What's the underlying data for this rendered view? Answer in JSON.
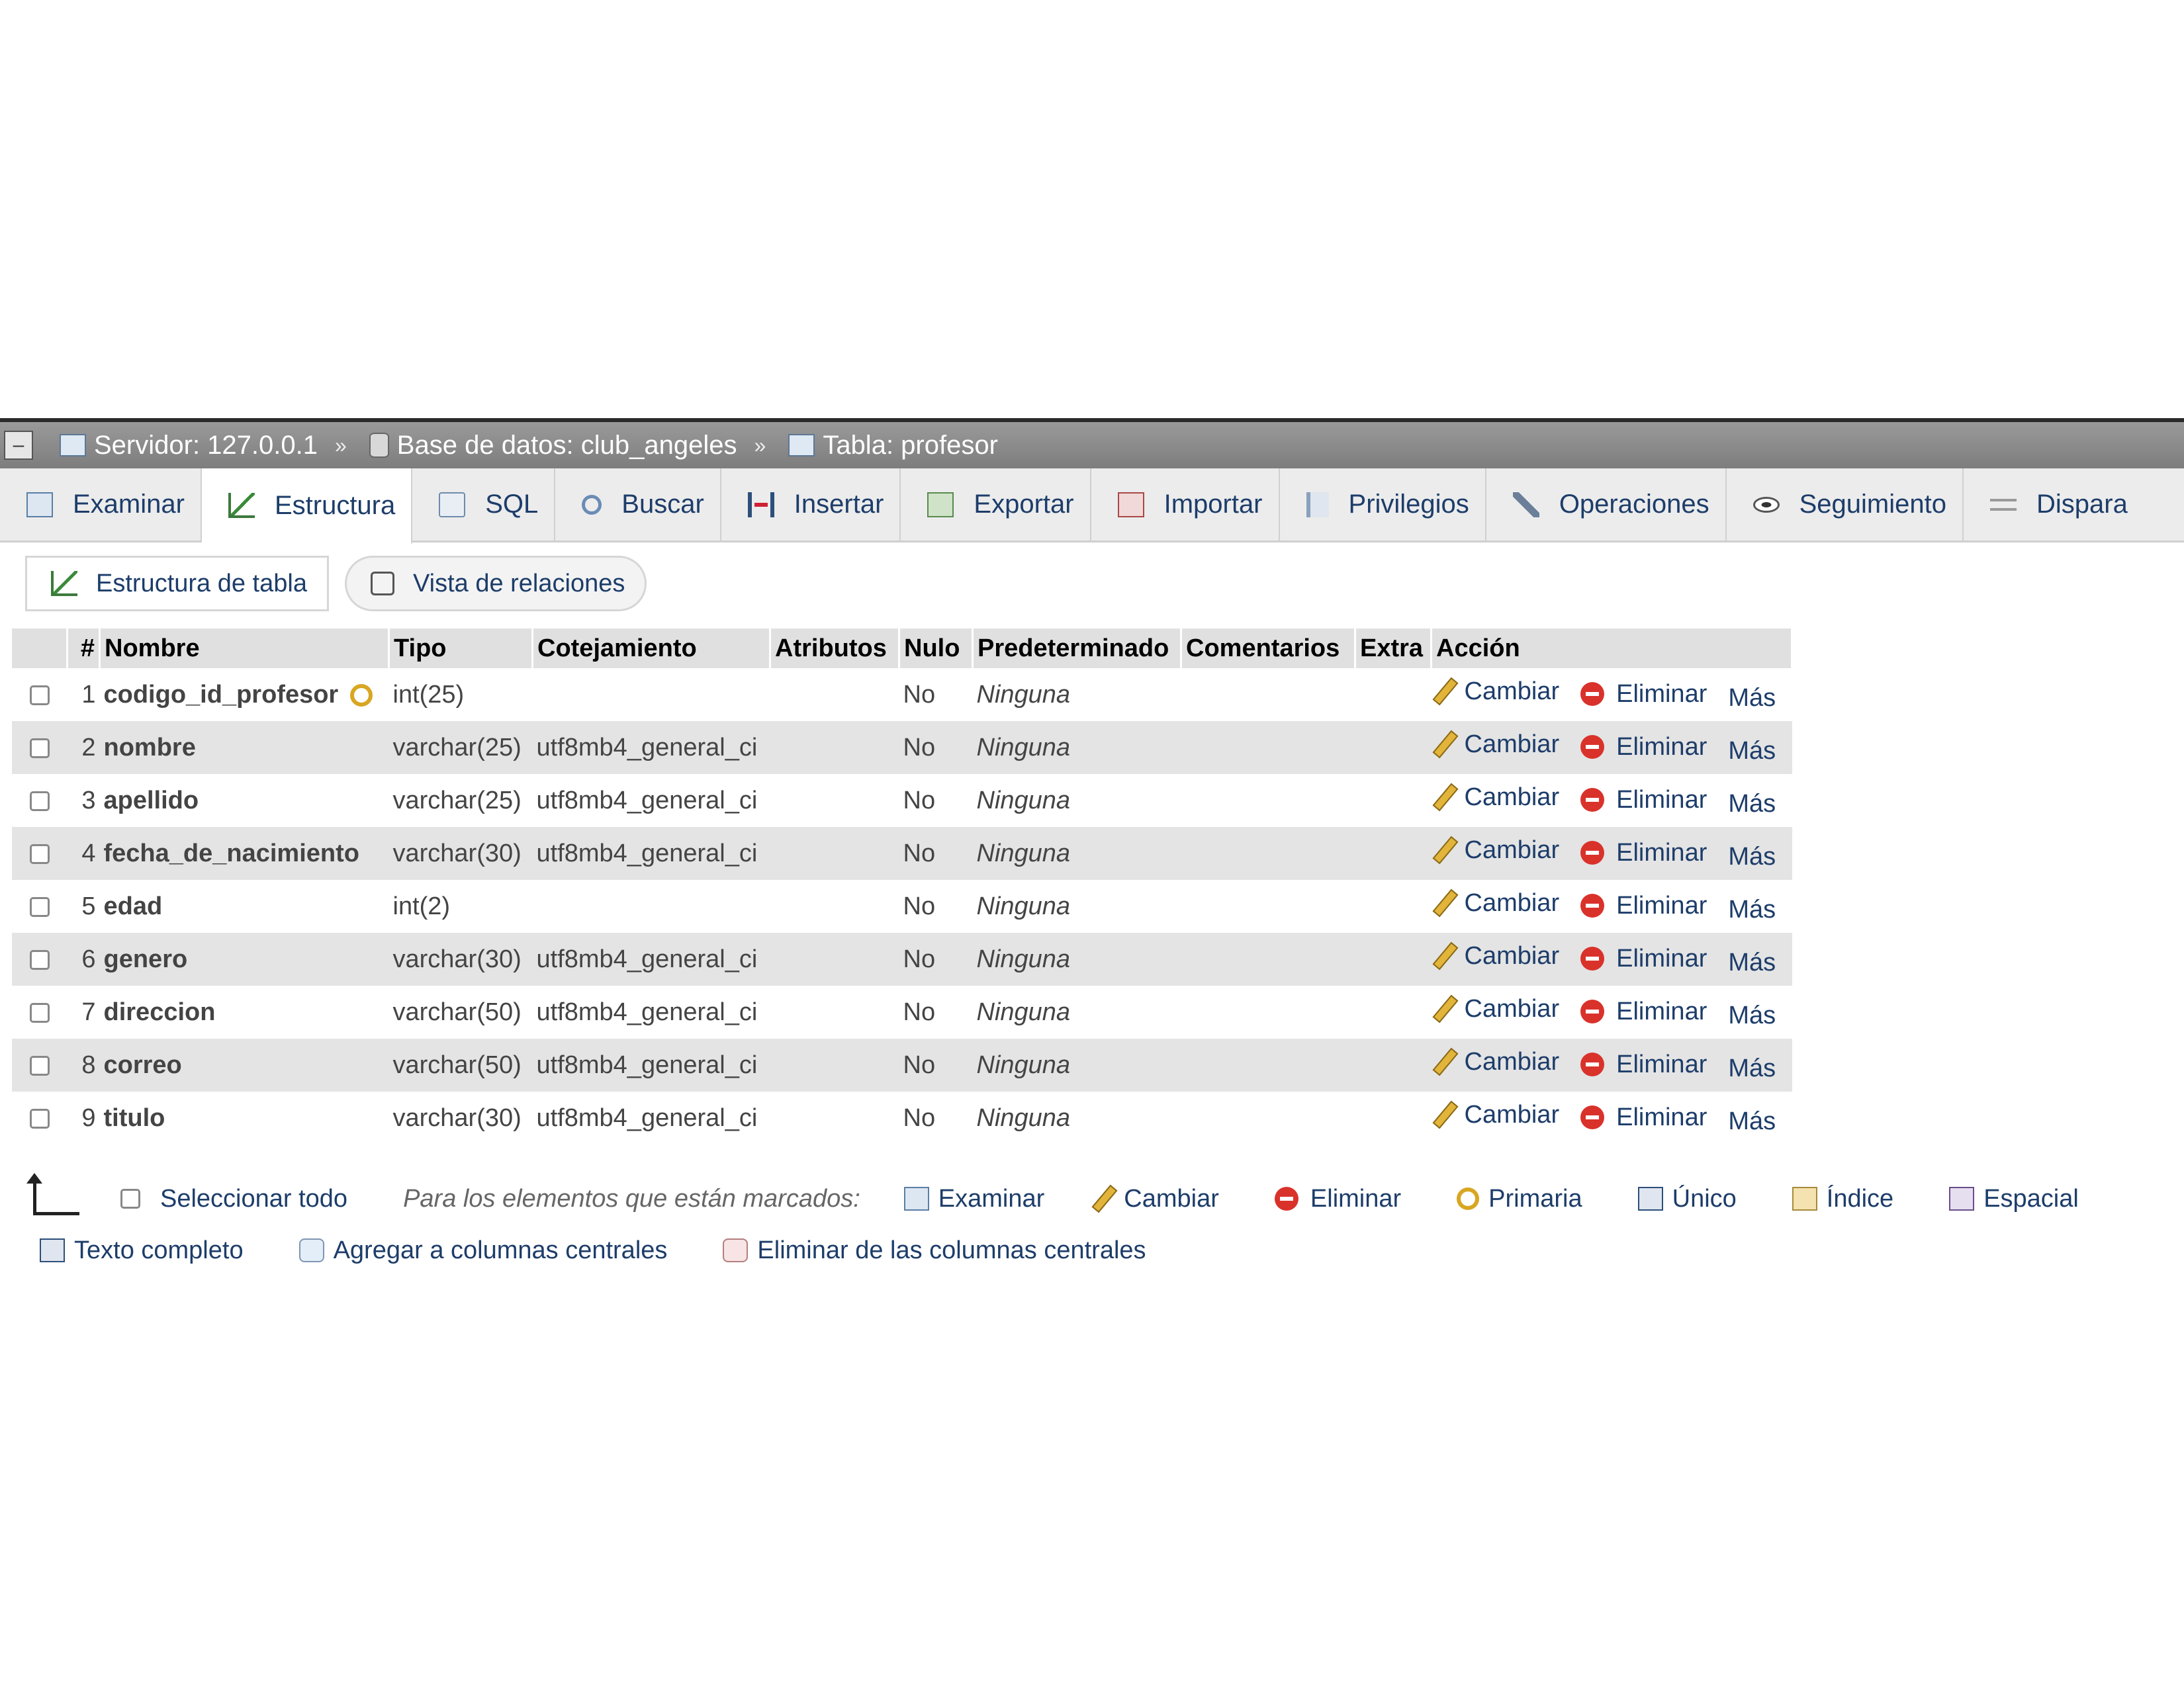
{
  "breadcrumb": {
    "server": "Servidor: 127.0.0.1",
    "database": "Base de datos: club_angeles",
    "table": "Tabla: profesor",
    "separator": "»"
  },
  "tabs": [
    {
      "label": "Examinar",
      "icon": "browse-icon"
    },
    {
      "label": "Estructura",
      "icon": "structure-icon",
      "active": true
    },
    {
      "label": "SQL",
      "icon": "sql-icon"
    },
    {
      "label": "Buscar",
      "icon": "search-icon"
    },
    {
      "label": "Insertar",
      "icon": "insert-icon"
    },
    {
      "label": "Exportar",
      "icon": "export-icon"
    },
    {
      "label": "Importar",
      "icon": "import-icon"
    },
    {
      "label": "Privilegios",
      "icon": "privileges-icon"
    },
    {
      "label": "Operaciones",
      "icon": "wrench-icon"
    },
    {
      "label": "Seguimiento",
      "icon": "eye-icon"
    },
    {
      "label": "Dispara",
      "icon": "trigger-icon"
    }
  ],
  "subtabs": {
    "structure": "Estructura de tabla",
    "relations": "Vista de relaciones"
  },
  "table": {
    "headers": [
      "#",
      "Nombre",
      "Tipo",
      "Cotejamiento",
      "Atributos",
      "Nulo",
      "Predeterminado",
      "Comentarios",
      "Extra",
      "Acción"
    ],
    "actions": {
      "change": "Cambiar",
      "drop": "Eliminar",
      "more": "Más"
    },
    "rows": [
      {
        "num": "1",
        "name": "codigo_id_profesor",
        "type": "int(25)",
        "collation": "",
        "null": "No",
        "default": "Ninguna",
        "primary_key": true
      },
      {
        "num": "2",
        "name": "nombre",
        "type": "varchar(25)",
        "collation": "utf8mb4_general_ci",
        "null": "No",
        "default": "Ninguna"
      },
      {
        "num": "3",
        "name": "apellido",
        "type": "varchar(25)",
        "collation": "utf8mb4_general_ci",
        "null": "No",
        "default": "Ninguna"
      },
      {
        "num": "4",
        "name": "fecha_de_nacimiento",
        "type": "varchar(30)",
        "collation": "utf8mb4_general_ci",
        "null": "No",
        "default": "Ninguna"
      },
      {
        "num": "5",
        "name": "edad",
        "type": "int(2)",
        "collation": "",
        "null": "No",
        "default": "Ninguna"
      },
      {
        "num": "6",
        "name": "genero",
        "type": "varchar(30)",
        "collation": "utf8mb4_general_ci",
        "null": "No",
        "default": "Ninguna"
      },
      {
        "num": "7",
        "name": "direccion",
        "type": "varchar(50)",
        "collation": "utf8mb4_general_ci",
        "null": "No",
        "default": "Ninguna"
      },
      {
        "num": "8",
        "name": "correo",
        "type": "varchar(50)",
        "collation": "utf8mb4_general_ci",
        "null": "No",
        "default": "Ninguna"
      },
      {
        "num": "9",
        "name": "titulo",
        "type": "varchar(30)",
        "collation": "utf8mb4_general_ci",
        "null": "No",
        "default": "Ninguna"
      }
    ]
  },
  "bulk": {
    "select_all": "Seleccionar todo",
    "marked_label": "Para los elementos que están marcados:",
    "actions": [
      "Examinar",
      "Cambiar",
      "Eliminar",
      "Primaria",
      "Único",
      "Índice",
      "Espacial"
    ],
    "actions_row2": [
      "Texto completo",
      "Agregar a columnas centrales",
      "Eliminar de las columnas centrales"
    ]
  },
  "colors": {
    "link": "#1d3d6a",
    "header_bg": "#e0e0e0",
    "row_alt": "#e4e4e4",
    "drop_red": "#d9322b",
    "pencil": "#e2b43a"
  }
}
